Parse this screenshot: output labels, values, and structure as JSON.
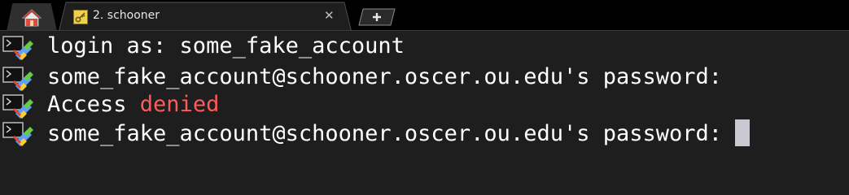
{
  "tabs": {
    "home_icon": "home-icon",
    "session_icon": "key-icon",
    "session_title": "2. schooner",
    "close_glyph": "✕",
    "new_tab_glyph": "+"
  },
  "terminal": {
    "line_icon": "terminal-session-icon",
    "lines": [
      {
        "text": "login as: some_fake_account"
      },
      {
        "text": "some_fake_account@schooner.oscer.ou.edu's password:"
      },
      {
        "prefix": "Access ",
        "highlight": "denied"
      },
      {
        "text": "some_fake_account@schooner.oscer.ou.edu's password: "
      }
    ]
  },
  "colors": {
    "background": "#1e1e1e",
    "text": "#ffffff",
    "error_text": "#ff5a5a",
    "cursor": "#c8c8d2"
  }
}
